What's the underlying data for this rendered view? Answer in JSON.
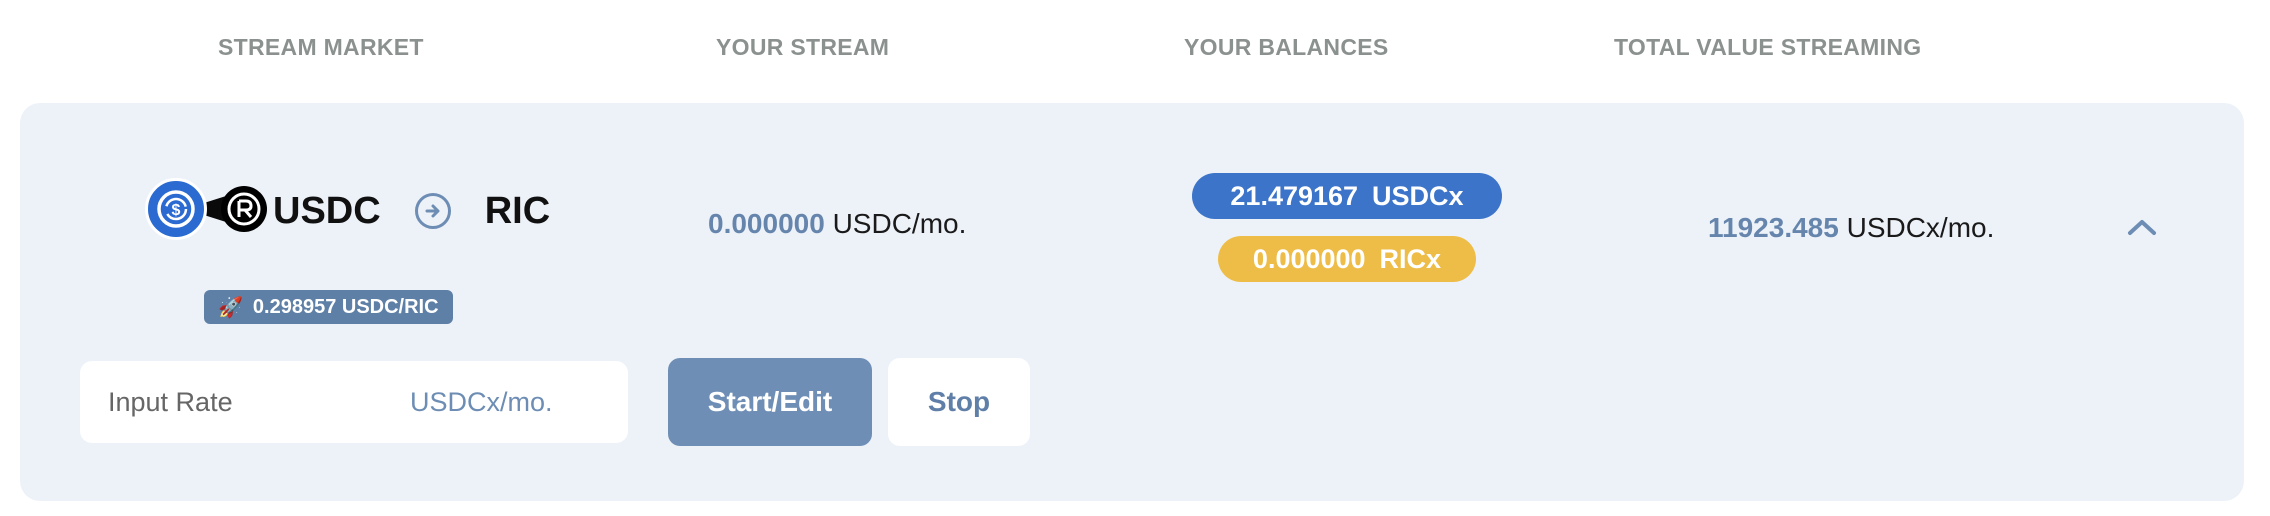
{
  "header": {
    "stream_market": "STREAM MARKET",
    "your_stream": "YOUR STREAM",
    "your_balances": "YOUR BALANCES",
    "total_value_streaming": "TOTAL VALUE STREAMING"
  },
  "market": {
    "from_token": "USDC",
    "to_token": "RIC",
    "rate_icon": "rocket-icon",
    "rate": "0.298957 USDC/RIC"
  },
  "stream": {
    "value": "0.000000",
    "unit": "USDC/mo."
  },
  "balances": [
    {
      "value": "21.479167",
      "unit": "USDCx",
      "color": "#3c74c9"
    },
    {
      "value": "0.000000",
      "unit": "RICx",
      "color": "#edbd48"
    }
  ],
  "total": {
    "value": "11923.485",
    "unit": "USDCx/mo."
  },
  "input": {
    "placeholder": "Input Rate",
    "unit": "USDCx/mo."
  },
  "buttons": {
    "start_edit": "Start/Edit",
    "stop": "Stop"
  },
  "colors": {
    "accent": "#6f8eb5",
    "card_bg": "#edf2f9"
  }
}
